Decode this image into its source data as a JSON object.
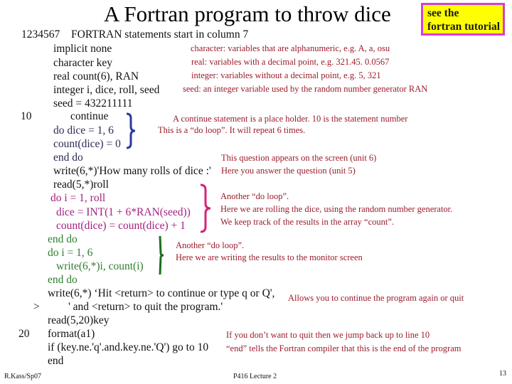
{
  "slide": {
    "title": "A Fortran program to throw dice",
    "tutorial_box": {
      "line1": "see the",
      "line2": "fortran tutorial",
      "bg_color": "#ffff00",
      "border_color": "#d63fd0"
    },
    "header_line": {
      "columns": "1234567",
      "text": "FORTRAN statements start in column 7"
    },
    "code_lines": [
      {
        "label": "",
        "text": "implicit none"
      },
      {
        "label": "",
        "text": "character key"
      },
      {
        "label": "",
        "text": "real count(6), RAN"
      },
      {
        "label": "",
        "text": "integer i, dice, roll, seed"
      },
      {
        "label": "",
        "text": "seed = 432211111"
      },
      {
        "label": "10",
        "text": "continue"
      },
      {
        "label": "",
        "text": "do  dice = 1, 6"
      },
      {
        "label": "",
        "text": "count(dice) = 0"
      },
      {
        "label": "",
        "text": "end do"
      },
      {
        "label": "",
        "text": "write(6,*)'How many rolls of dice :'"
      },
      {
        "label": "",
        "text": "read(5,*)roll"
      },
      {
        "label": "",
        "text": "do  i = 1, roll"
      },
      {
        "label": "",
        "text": "dice = INT(1 + 6*RAN(seed))"
      },
      {
        "label": "",
        "text": "count(dice) = count(dice) + 1"
      },
      {
        "label": "",
        "text": "end do"
      },
      {
        "label": "",
        "text": "do  i = 1, 6"
      },
      {
        "label": "",
        "text": "write(6,*)i, count(i)"
      },
      {
        "label": "",
        "text": "end do"
      },
      {
        "label": "",
        "text": "write(6,*) ‘Hit <return> to continue or type q or Q',"
      },
      {
        "label": ">",
        "text": "' and <return> to quit the program.'"
      },
      {
        "label": "",
        "text": "read(5,20)key"
      },
      {
        "label": "20",
        "text": "format(a1)"
      },
      {
        "label": "",
        "text": "if (key.ne.'q'.and.key.ne.'Q') go to 10"
      },
      {
        "label": "",
        "text": "end"
      }
    ],
    "notes": {
      "character": "character: variables that are alphanumeric, e.g. A, a, osu",
      "real": "real: variables with a decimal point, e.g. 321.45. 0.0567",
      "integer": "integer: variables without a decimal point, e.g. 5, 321",
      "seed": "seed: an integer variable used by the random number generator RAN",
      "continue": "A continue statement is a place holder. 10 is the statement number",
      "loop1": "This is a “do loop”. It will repeat 6 times.",
      "question": "This question appears on the screen (unit 6)",
      "answer": "Here you answer the question (unit 5)",
      "loop2_1": "Another “do loop”.",
      "loop2_2": "Here we are rolling the dice, using the random number generator.",
      "loop2_3": "We keep track of the results in the array “count”.",
      "loop3_1": "Another “do loop”.",
      "loop3_2": "Here we are writing the results to the monitor screen",
      "continue_quit": "Allows you to continue the program again or quit",
      "jump": "If you don’t want to quit then we jump back up to line 10",
      "end": "“end” tells the Fortran compiler that this is the end of the program"
    },
    "colors": {
      "note": "#9b1b2a",
      "loop1": "#2a2a55",
      "loop2": "#a3207f",
      "loop3": "#2e7d2e",
      "brace1": "#2b3aa0",
      "brace2": "#d8207a",
      "brace3": "#1f6e1f"
    },
    "footer": {
      "author": "R.Kass/Sp07",
      "lecture": "P416 Lecture 2",
      "page": "13"
    }
  }
}
